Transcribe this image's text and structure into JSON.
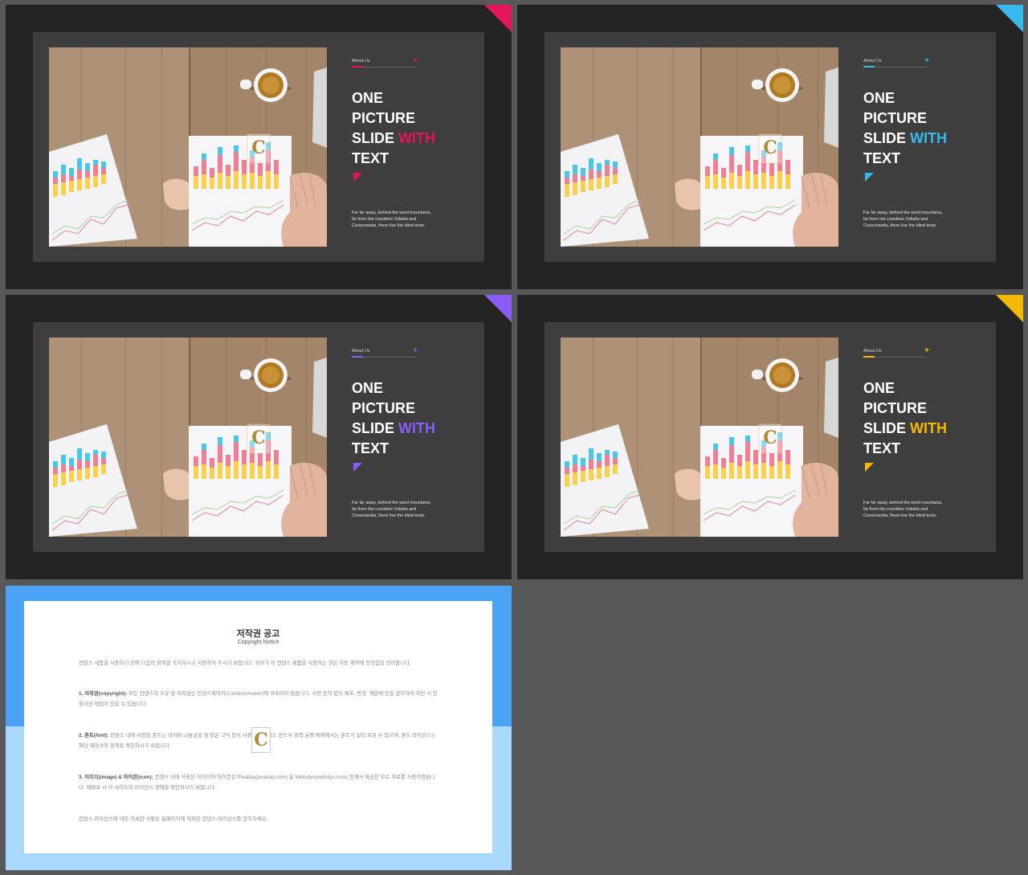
{
  "colors": {
    "background": "#58585a",
    "slide_bg": "#242424",
    "panel_bg": "#3e3e3e",
    "notice_top": "#4aa3f4",
    "notice_bottom": "#a8d8fb"
  },
  "slides": [
    {
      "accent": "#e6155a",
      "about_label": "About Us",
      "plus": "+",
      "title_lines": [
        "ONE",
        "PICTURE",
        "SLIDE"
      ],
      "title_accent": "WITH",
      "title_last": "TEXT",
      "body": "Far far away, behind the word mountains, far from the countries Vokalia and Consonantia, there live the blind texts."
    },
    {
      "accent": "#38b9ec",
      "about_label": "About Us",
      "plus": "+",
      "title_lines": [
        "ONE",
        "PICTURE",
        "SLIDE"
      ],
      "title_accent": "WITH",
      "title_last": "TEXT",
      "body": "Far far away, behind the word mountains, far from the countries Vokalia and Consonantia, there live the blind texts."
    },
    {
      "accent": "#8b5cf6",
      "about_label": "About Us",
      "plus": "+",
      "title_lines": [
        "ONE",
        "PICTURE",
        "SLIDE"
      ],
      "title_accent": "WITH",
      "title_last": "TEXT",
      "body": "Far far away, behind the word mountains, far from the countries Vokalia and Consonantia, there live the blind texts."
    },
    {
      "accent": "#f5b800",
      "about_label": "About Us",
      "plus": "+",
      "title_lines": [
        "ONE",
        "PICTURE",
        "SLIDE"
      ],
      "title_accent": "WITH",
      "title_last": "TEXT",
      "body": "Far far away, behind the word mountains, far from the countries Vokalia and Consonantia, there live the blind texts."
    }
  ],
  "photo": {
    "logo_letter": "C",
    "logo_text": "CONTENTS"
  },
  "notice": {
    "title": "저작권 공고",
    "subtitle": "Copyright Notice",
    "intro": "컨텐스 세품을 사용하기 전에 다음의 항목을 숙지하시고 사용하여 주시기 바랍니다. 귀하가 이 컨텐스 제품을 사용하는 것은 자동 계약에 동의함을 의미합니다.",
    "section1_head": "1. 저작권(copyright):",
    "section1": "모든 컨텐스의 소유 및 저작권은 컨텐스메이커(Contentsmaker)에 귀속되어 있습니다. 사전 동의 없이 배포, 변경, 재판매 등을 금지하며 위반 시 민형사상 책임이 있을 수 있습니다.",
    "section2_head": "2. 폰트(font):",
    "section2": "컨텐스 내에 사용된 폰트는 네이버 나눔글꼴 및 맑은 고딕 등이 사용되었습니다. 윈도우 외의 운영 체제에서는 폰트가 달리 보일 수 있으며, 폰트 라이선스는 해당 제작사의 정책을 확인하시기 바랍니다.",
    "section3_head": "3. 이미지(image) & 아이콘(icon):",
    "section3": "컨텐스 내에 사용된 이미지와 아이콘은 Pixabay(pixabay.com) 및 Webolys(webolys.com) 등에서 제공한 무료 자료를 사용하였습니다. 재배포 시 각 사이트의 라이선스 정책을 확인하시기 바랍니다.",
    "outro": "컨텐스 라이선스에 대한 자세한 사항은 홈페이지에 게재된 컨텐스 라이선스를 참조하세요."
  }
}
